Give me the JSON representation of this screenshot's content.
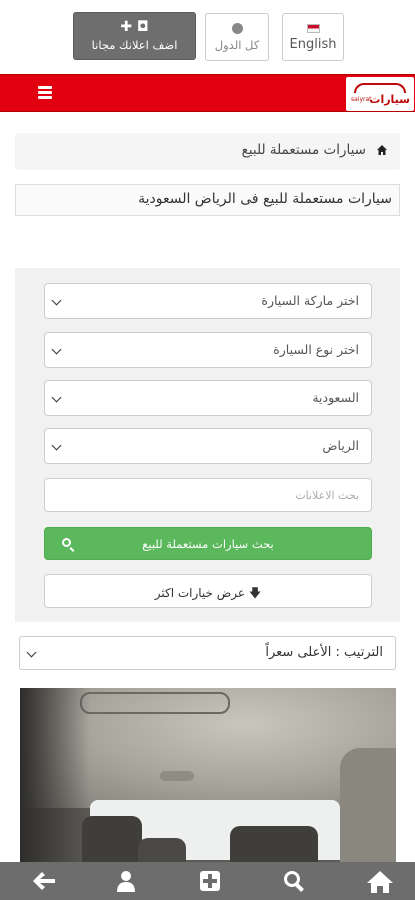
{
  "header": {
    "add_ad_label": "اضف اعلانك مجانا",
    "countries_label": "كل الدول",
    "language_label": "English"
  },
  "navbar": {
    "logo_text": "سيارات",
    "logo_subtext": "saiyrat"
  },
  "breadcrumb": {
    "current": "سيارات مستعملة للبيع"
  },
  "page_title": "سيارات مستعملة للبيع فى الرياض السعودية",
  "search": {
    "brand_select": "اختر ماركة السيارة",
    "type_select": "اختر نوع السيارة",
    "country_select": "السعودية",
    "city_select": "الرياض",
    "keyword_placeholder": "بحث الاعلانات",
    "submit_label": "بحث سيارات مستعملة للبيع",
    "more_options_label": "عرض خيارات اكثر"
  },
  "sort": {
    "selected": "الترتيب : الأعلى سعراً"
  },
  "bottom_nav": {
    "items": [
      "back-icon",
      "user-icon",
      "add-icon",
      "search-icon",
      "home-icon"
    ]
  },
  "colors": {
    "navbar": "#e1000f",
    "search_button": "#5cb85c",
    "bottom_nav": "#6d6d6d",
    "add_button": "#6e6e6e"
  }
}
